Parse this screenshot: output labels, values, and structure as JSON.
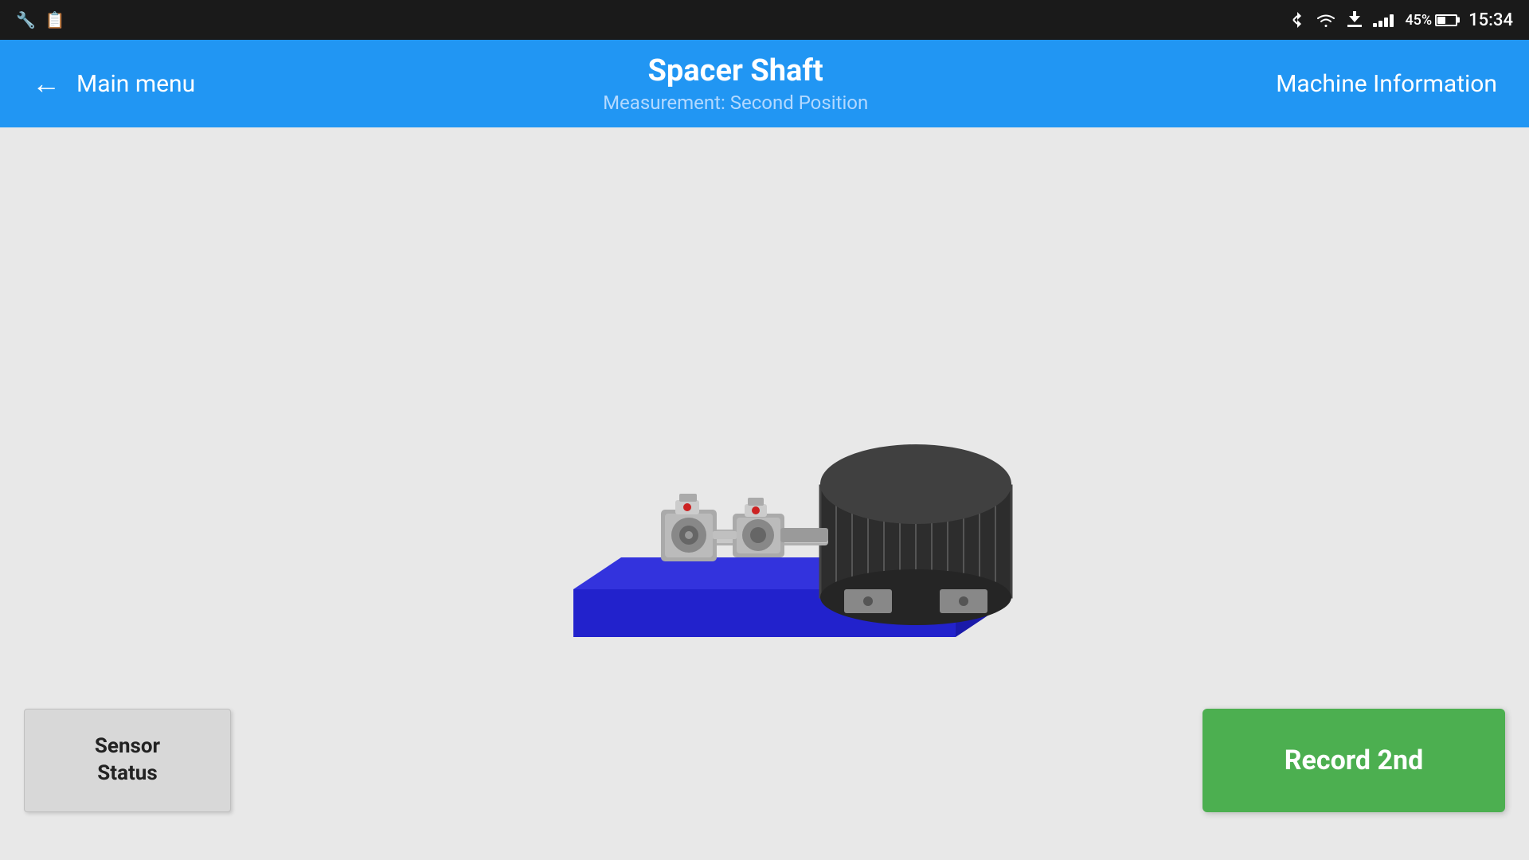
{
  "status_bar": {
    "battery_percent": "45%",
    "time": "15:34",
    "icons": {
      "bluetooth": "bluetooth-icon",
      "download": "download-icon",
      "signal": "signal-icon",
      "wifi": "wifi-icon",
      "battery": "battery-icon"
    }
  },
  "nav": {
    "back_label": "Main menu",
    "title": "Spacer Shaft",
    "subtitle": "Measurement: Second Position",
    "right_label": "Machine Information"
  },
  "main": {
    "sensor_status_label_line1": "Sensor",
    "sensor_status_label_line2": "Status",
    "record_button_label": "Record 2nd"
  }
}
